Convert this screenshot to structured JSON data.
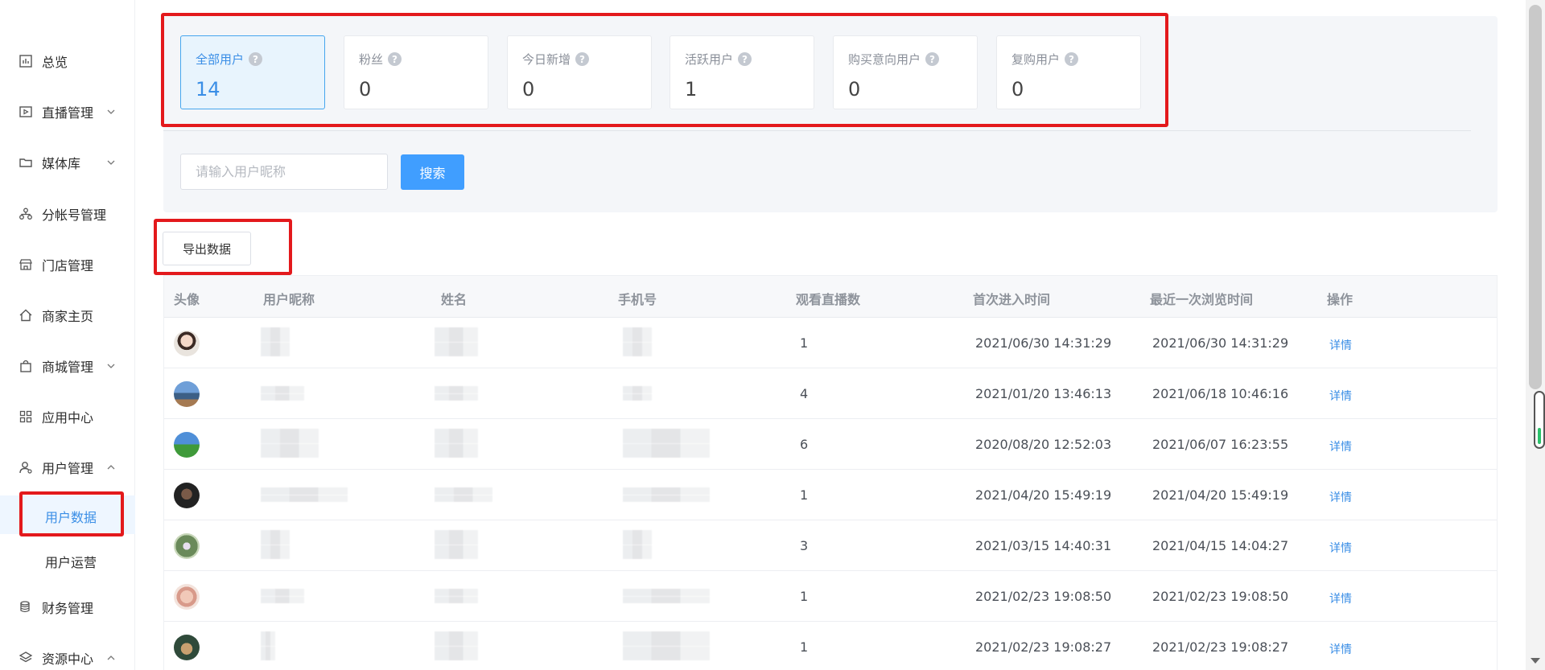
{
  "sidebar": {
    "items": [
      {
        "label": "总览",
        "icon": "chart-icon"
      },
      {
        "label": "直播管理",
        "icon": "play-icon"
      },
      {
        "label": "媒体库",
        "icon": "folder-icon"
      },
      {
        "label": "分帐号管理",
        "icon": "org-icon"
      },
      {
        "label": "门店管理",
        "icon": "store-icon"
      },
      {
        "label": "商家主页",
        "icon": "home-icon"
      },
      {
        "label": "商城管理",
        "icon": "bag-icon"
      },
      {
        "label": "应用中心",
        "icon": "grid-icon"
      },
      {
        "label": "用户管理",
        "icon": "user-icon"
      },
      {
        "label": "财务管理",
        "icon": "coins-icon"
      },
      {
        "label": "资源中心",
        "icon": "layers-icon"
      }
    ],
    "sub_items": [
      {
        "label": "用户数据",
        "active": true
      },
      {
        "label": "用户运营",
        "active": false
      }
    ]
  },
  "stats": [
    {
      "label": "全部用户",
      "value": "14",
      "active": true
    },
    {
      "label": "粉丝",
      "value": "0",
      "active": false
    },
    {
      "label": "今日新增",
      "value": "0",
      "active": false
    },
    {
      "label": "活跃用户",
      "value": "1",
      "active": false
    },
    {
      "label": "购买意向用户",
      "value": "0",
      "active": false
    },
    {
      "label": "复购用户",
      "value": "0",
      "active": false
    }
  ],
  "help_glyph": "?",
  "search": {
    "placeholder": "请输入用户昵称",
    "value": "",
    "button_label": "搜索"
  },
  "export_label": "导出数据",
  "table": {
    "headers": [
      "头像",
      "用户昵称",
      "姓名",
      "手机号",
      "观看直播数",
      "首次进入时间",
      "最近一次浏览时间",
      "操作"
    ],
    "action_label": "详情",
    "rows": [
      {
        "views": "1",
        "first_visit": "2021/06/30 14:31:29",
        "last_visit": "2021/06/30 14:31:29"
      },
      {
        "views": "4",
        "first_visit": "2021/01/20 13:46:13",
        "last_visit": "2021/06/18 10:46:16"
      },
      {
        "views": "6",
        "first_visit": "2020/08/20 12:52:03",
        "last_visit": "2021/06/07 16:23:55"
      },
      {
        "views": "1",
        "first_visit": "2021/04/20 15:49:19",
        "last_visit": "2021/04/20 15:49:19"
      },
      {
        "views": "3",
        "first_visit": "2021/03/15 14:40:31",
        "last_visit": "2021/04/15 14:04:27"
      },
      {
        "views": "1",
        "first_visit": "2021/02/23 19:08:50",
        "last_visit": "2021/02/23 19:08:50"
      },
      {
        "views": "1",
        "first_visit": "2021/02/23 19:08:27",
        "last_visit": "2021/02/23 19:08:27"
      }
    ]
  },
  "colors": {
    "accent": "#409eff",
    "highlight": "#e3191c",
    "active_bg": "#e8f4fd"
  }
}
